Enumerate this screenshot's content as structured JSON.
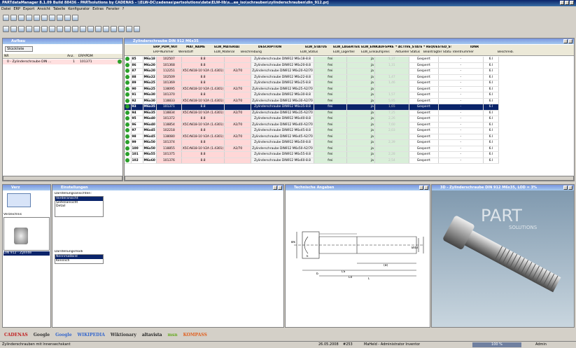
{
  "window": {
    "title": "PARTdataManager 8.1.09 Build 88436 - PARTsolutions by CADENAS - \\\\ELW-DC\\cadenas\\partsolutions\\data\\ELW-Iib\\s...ee_iso\\schrauben\\zylinderschrauben\\din_912.prj"
  },
  "menu": [
    "Datei",
    "ERP",
    "Export",
    "Ansicht",
    "Tabelle",
    "Konfigurator",
    "Extras",
    "Fenster",
    "?"
  ],
  "aufbau": {
    "title": "Aufbau",
    "tab": "Stückliste",
    "cols": [
      "NR",
      "Anz.",
      "ERP/PDM"
    ],
    "row": {
      "name": "0 - Zylinderschraube DIN ...",
      "qty": "1",
      "erp": "101371"
    }
  },
  "table": {
    "title": "Zylinderschraube DIN 912 M6x35",
    "columns": [
      {
        "h": "ERP_PDM_NUMBER",
        "s": "ERP-Nummer"
      },
      {
        "h": "MAT_NAME",
        "s": "Werkstoff"
      },
      {
        "h": "ELW_MATERIAL",
        "s": "ELW_Material"
      },
      {
        "h": "DESCRIPTION",
        "s": "Beschreibung"
      },
      {
        "h": "ELW_STATUS",
        "s": "ELW_Status"
      },
      {
        "h": "ELW_LAGERTEIL",
        "s": "ELW_Lagerteil"
      },
      {
        "h": "ELW_EINKAUFSPREIS",
        "s": "ELW_Einkaufspreis"
      },
      {
        "h": "* ACTIVE_STATE",
        "s": "Aktueller Status"
      },
      {
        "h": "* REQUESTED_STATE",
        "s": "Beantragter Status"
      },
      {
        "h": "IDNR",
        "s": "Identnummer"
      },
      {
        "h": "",
        "s": "Beschreib."
      }
    ],
    "rows": [
      [
        "85",
        "M6x18",
        "102507",
        "8.8",
        "",
        "Zylinderschraube DIN912 M6x18-8.8",
        "frei",
        "ja",
        "1,37",
        "Gesperrt",
        "-",
        "6.I"
      ],
      [
        "86",
        "M6x20",
        "101368",
        "8.8",
        "",
        "Zylinderschraube DIN912 M6x20-8.8",
        "frei",
        "ja",
        "1,31",
        "Gesperrt",
        "-",
        "6.I"
      ],
      [
        "87",
        "M6x20",
        "112251",
        "X5CrNi18-10 V2A (1.4301)",
        "A2/70",
        "Zylinderschraube DIN912 M6x20-A2/70",
        "frei",
        "ja",
        "",
        "Gesperrt",
        "-",
        "6.I"
      ],
      [
        "88",
        "M6x22",
        "102509",
        "8.8",
        "",
        "Zylinderschraube DIN912 M6x22-8.8",
        "frei",
        "ja",
        "1,47",
        "Gesperrt",
        "-",
        "6.I"
      ],
      [
        "89",
        "M6x25",
        "101369",
        "8.8",
        "",
        "Zylinderschraube DIN912 M6x25-8.8",
        "frei",
        "ja",
        "1,46",
        "Gesperrt",
        "-",
        "6.I"
      ],
      [
        "90",
        "M6x25",
        "138095",
        "X5CrNi18-10 V2A (1.4301)",
        "A2/70",
        "Zylinderschraube DIN912 M6x25-A2/70",
        "frei",
        "ja",
        "",
        "Gesperrt",
        "-",
        "6.I"
      ],
      [
        "91",
        "M6x30",
        "101370",
        "8.8",
        "",
        "Zylinderschraube DIN912 M6x30-8.8",
        "frei",
        "ja",
        "1,57",
        "Gesperrt",
        "-",
        "6.I"
      ],
      [
        "92",
        "M6x30",
        "118833",
        "X5CrNi18-10 V2A (1.4301)",
        "A2/70",
        "Zylinderschraube DIN912 M6x30-A2/70",
        "frei",
        "ja",
        "5,95",
        "Gesperrt",
        "-",
        "6.I"
      ],
      [
        "93",
        "M6x35",
        "101371",
        "8.8",
        "",
        "Zylinderschraube DIN912 M6x35-8.8",
        "frei",
        "ja",
        "1,65",
        "Gesperrt",
        "-",
        "6.I"
      ],
      [
        "94",
        "M6x35",
        "118834",
        "X5CrNi18-10 V2A (1.4301)",
        "A2/70",
        "Zylinderschraube DIN912 M6x35-A2/70",
        "frei",
        "ja",
        "7,25",
        "Gesperrt",
        "-",
        "6.I"
      ],
      [
        "95",
        "M6x40",
        "101372",
        "8.8",
        "",
        "Zylinderschraube DIN912 M6x40-8.8",
        "frei",
        "ja",
        "2,26",
        "Gesperrt",
        "-",
        "6.I"
      ],
      [
        "96",
        "M6x40",
        "118854",
        "X5CrNi18-10 V2A (1.4301)",
        "A2/70",
        "Zylinderschraube DIN912 M6x40-A2/70",
        "frei",
        "ja",
        "7,60",
        "Gesperrt",
        "-",
        "6.I"
      ],
      [
        "97",
        "M6x45",
        "102218",
        "8.8",
        "",
        "Zylinderschraube DIN912 M6x45-8.8",
        "frei",
        "ja",
        "2,03",
        "Gesperrt",
        "-",
        "6.I"
      ],
      [
        "98",
        "M6x45",
        "138080",
        "X5CrNi18-10 V2A (1.4301)",
        "A2/70",
        "Zylinderschraube DIN912 M6x45-A2/70",
        "frei",
        "ja",
        "",
        "Gesperrt",
        "-",
        "6.I"
      ],
      [
        "99",
        "M6x50",
        "101374",
        "8.8",
        "",
        "Zylinderschraube DIN912 M6x50-8.8",
        "frei",
        "ja",
        "2,39",
        "Gesperrt",
        "-",
        "6.I"
      ],
      [
        "100",
        "M6x50",
        "118855",
        "X5CrNi18-10 V2A (1.4301)",
        "A2/70",
        "Zylinderschraube DIN912 M6x50-A2/70",
        "frei",
        "ja",
        "",
        "Gesperrt",
        "-",
        "6.I"
      ],
      [
        "101",
        "M6x55",
        "101375",
        "8.8",
        "",
        "Zylinderschraube DIN912 M6x55-8.8",
        "frei",
        "ja",
        "2,28",
        "Gesperrt",
        "-",
        "6.I"
      ],
      [
        "102",
        "M6x60",
        "101376",
        "8.8",
        "",
        "Zylinderschraube DIN912 M6x60-8.8",
        "frei",
        "ja",
        "2,54",
        "Gesperrt",
        "-",
        "6.I"
      ]
    ],
    "selected_index": 8
  },
  "verz": {
    "title": "Verz",
    "label": "Verzeichnis",
    "item": "DIN 912 - Zylinde"
  },
  "einst": {
    "title": "Einstellungen",
    "views_label": "Darstellungsansichten:",
    "views": [
      "Vorderansicht",
      "Seitenansicht",
      "Detail"
    ],
    "modes_label": "Darstellungsmodi",
    "modes": [
      "Nennmaßbild",
      "Kennlich"
    ]
  },
  "tech": {
    "title": "Technische Angaben",
    "dims": [
      "Ød",
      "Øk",
      "dk",
      "b",
      "LS",
      "L0",
      "(B)",
      "L",
      "ØD",
      "Ød3",
      "k",
      "s",
      "t",
      "v"
    ]
  },
  "view3d": {
    "title": "3D - Zylinderschraube DIN 912 M6x35, LOD = 3%",
    "logo": "PART",
    "logo_sub": "SOLUTIONS"
  },
  "links": [
    "CADENAS",
    "Google",
    "Google",
    "WIKIPEDIA",
    "Wiktionary",
    "altavista",
    "msn",
    "KOMPASS"
  ],
  "status": {
    "left": "Zylinderschrauben mit Innensechskant",
    "date": "26.05.2008",
    "num": "#253",
    "user": "MaHeld - Administrator Inventor",
    "progress": "100 %",
    "role": "Admin"
  }
}
